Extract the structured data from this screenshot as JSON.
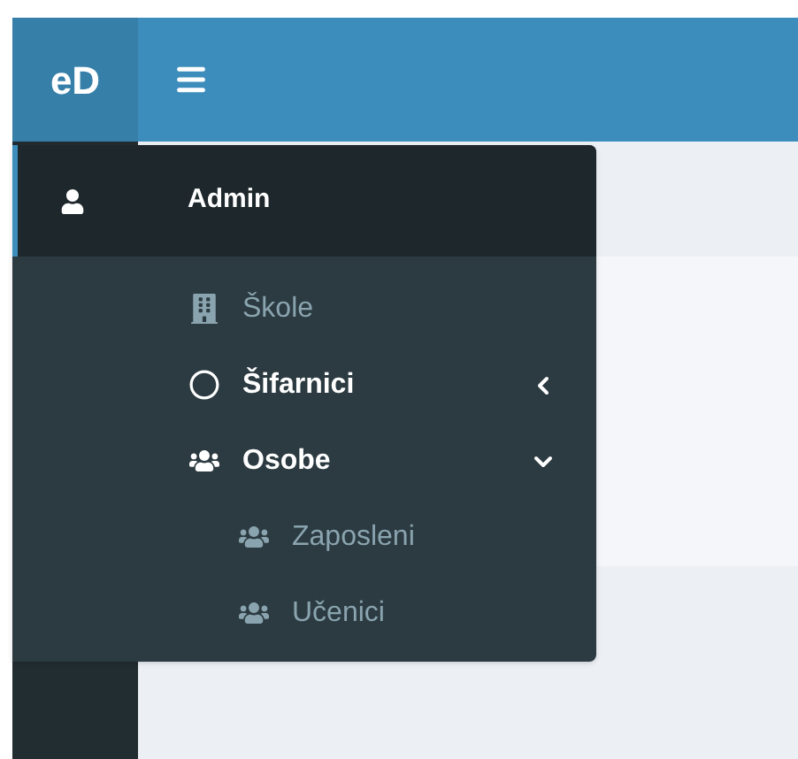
{
  "header": {
    "logo": "eD"
  },
  "user_menu": {
    "label": "Admin"
  },
  "menu": [
    {
      "label": "Škole",
      "kind": "link"
    },
    {
      "label": "Šifarnici",
      "kind": "tree",
      "expanded": false
    },
    {
      "label": "Osobe",
      "kind": "tree",
      "expanded": true,
      "children": [
        {
          "label": "Zaposleni"
        },
        {
          "label": "Učenici"
        }
      ]
    }
  ]
}
